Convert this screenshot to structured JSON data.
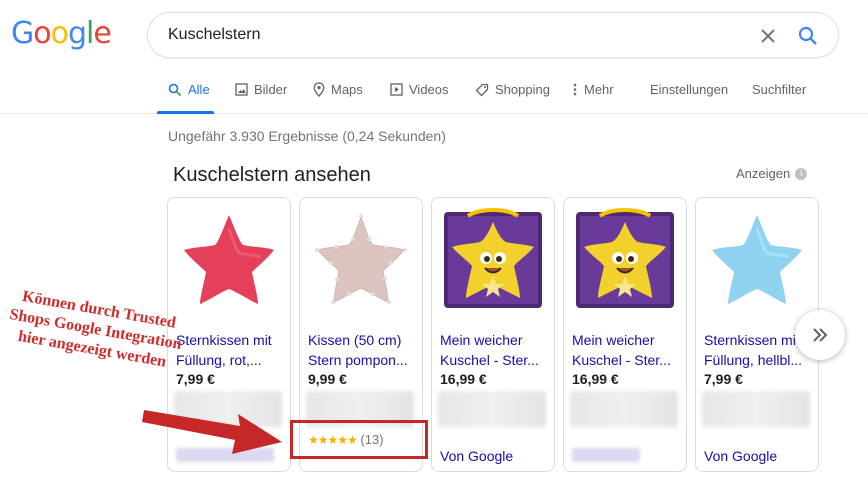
{
  "logo": {
    "letters": [
      {
        "char": "G",
        "color": "#4285F4"
      },
      {
        "char": "o",
        "color": "#EA4335"
      },
      {
        "char": "o",
        "color": "#FBBC05"
      },
      {
        "char": "g",
        "color": "#4285F4"
      },
      {
        "char": "l",
        "color": "#34A853"
      },
      {
        "char": "e",
        "color": "#EA4335"
      }
    ]
  },
  "search": {
    "value": "Kuschelstern"
  },
  "tabs": {
    "all": "Alle",
    "images": "Bilder",
    "maps": "Maps",
    "videos": "Videos",
    "shopping": "Shopping",
    "more": "Mehr",
    "settings": "Einstellungen",
    "tools": "Suchfilter"
  },
  "result_stats": "Ungefähr 3.930 Ergebnisse (0,24 Sekunden)",
  "shopping": {
    "title": "Kuschelstern ansehen",
    "ads_label": "Anzeigen",
    "ads_info": "i",
    "cards": [
      {
        "name": "Sternkissen mit Füllung, rot,...",
        "price": "7,99 €"
      },
      {
        "name": "Kissen (50 cm) Stern pompon...",
        "price": "9,99 €",
        "stars": "★★★★★",
        "reviews": "(13)"
      },
      {
        "name": "Mein weicher Kuschel - Ster...",
        "price": "16,99 €",
        "seller": "Von Google"
      },
      {
        "name": "Mein weicher Kuschel - Ster...",
        "price": "16,99 €"
      },
      {
        "name": "Sternkissen mit Füllung, hellbl...",
        "price": "7,99 €",
        "seller": "Von Google"
      }
    ]
  },
  "annotation": {
    "text": "Können durch Trusted Shops Google Integration hier angezeigt werden"
  },
  "colors": {
    "link": "#1a0dab",
    "accent": "#1a73e8",
    "annotation_red": "#c62828",
    "star": "#f4b400"
  }
}
